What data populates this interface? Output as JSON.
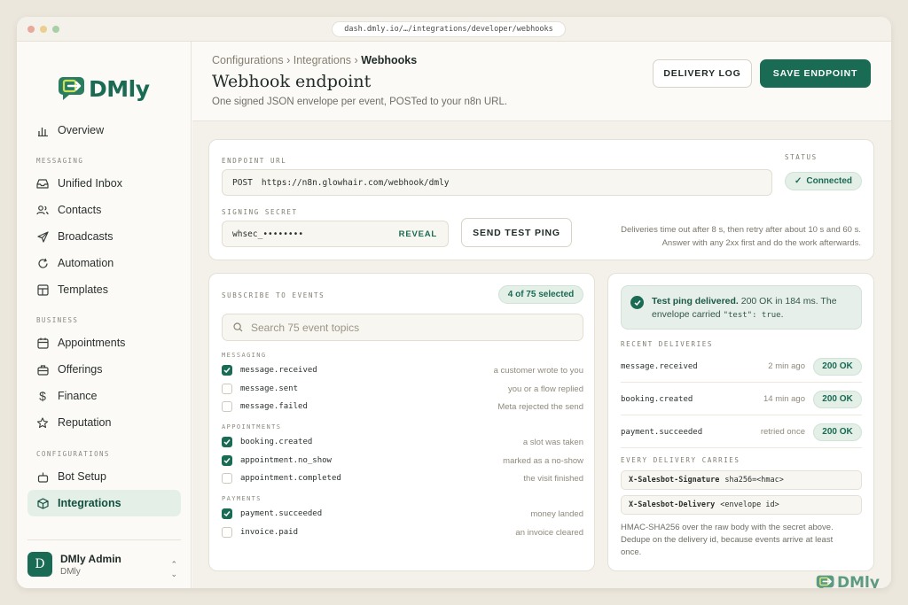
{
  "browser": {
    "url": "dash.dmly.io/…/integrations/developer/webhooks"
  },
  "brand": {
    "name": "DMly",
    "color": "#1a6b54"
  },
  "sidebar": {
    "overview": "Overview",
    "sections": {
      "messaging": "MESSAGING",
      "business": "BUSINESS",
      "configurations": "CONFIGURATIONS"
    },
    "items": {
      "unified_inbox": "Unified Inbox",
      "contacts": "Contacts",
      "broadcasts": "Broadcasts",
      "automation": "Automation",
      "templates": "Templates",
      "appointments": "Appointments",
      "offerings": "Offerings",
      "finance": "Finance",
      "reputation": "Reputation",
      "bot_setup": "Bot Setup",
      "integrations": "Integrations"
    },
    "user": {
      "initial": "D",
      "name": "DMly Admin",
      "org": "DMly"
    }
  },
  "header": {
    "breadcrumb": [
      "Configurations",
      "Integrations",
      "Webhooks"
    ],
    "title": "Webhook endpoint",
    "subtitle": "One signed JSON envelope per event, POSTed to your n8n URL.",
    "delivery_log": "DELIVERY LOG",
    "save_endpoint": "SAVE ENDPOINT"
  },
  "endpoint": {
    "url_label": "ENDPOINT URL",
    "method": "POST",
    "url": "https://n8n.glowhair.com/webhook/dmly",
    "secret_label": "SIGNING SECRET",
    "secret": "whsec_••••••••",
    "reveal": "REVEAL",
    "send_test": "SEND TEST PING",
    "status_label": "STATUS",
    "status": "Connected",
    "note_line1": "Deliveries time out after 8 s, then retry after about 10 s and 60 s.",
    "note_line2": "Answer with any 2xx first and do the work afterwards."
  },
  "events": {
    "label": "SUBSCRIBE TO EVENTS",
    "selected": "4 of 75 selected",
    "search_placeholder": "Search 75 event topics",
    "groups": {
      "messaging": "MESSAGING",
      "appointments": "APPOINTMENTS",
      "payments": "PAYMENTS"
    },
    "items": [
      {
        "name": "message.received",
        "desc": "a customer wrote to you",
        "checked": true
      },
      {
        "name": "message.sent",
        "desc": "you or a flow replied",
        "checked": false
      },
      {
        "name": "message.failed",
        "desc": "Meta rejected the send",
        "checked": false
      },
      {
        "name": "booking.created",
        "desc": "a slot was taken",
        "checked": true
      },
      {
        "name": "appointment.no_show",
        "desc": "marked as a no-show",
        "checked": true
      },
      {
        "name": "appointment.completed",
        "desc": "the visit finished",
        "checked": false
      },
      {
        "name": "payment.succeeded",
        "desc": "money landed",
        "checked": true
      },
      {
        "name": "invoice.paid",
        "desc": "an invoice cleared",
        "checked": false
      }
    ]
  },
  "deliveries": {
    "banner_bold": "Test ping delivered.",
    "banner_rest": " 200 OK in 184 ms. The",
    "banner_line2_pre": "envelope carried ",
    "banner_code": "\"test\": true",
    "banner_end": ".",
    "recent_label": "RECENT DELIVERIES",
    "rows": [
      {
        "name": "message.received",
        "time": "2 min ago",
        "status": "200 OK"
      },
      {
        "name": "booking.created",
        "time": "14 min ago",
        "status": "200 OK"
      },
      {
        "name": "payment.succeeded",
        "time": "retried once",
        "status": "200 OK"
      }
    ],
    "carries_label": "EVERY DELIVERY CARRIES",
    "headers": [
      {
        "name": "X-Salesbot-Signature",
        "value": "sha256=<hmac>"
      },
      {
        "name": "X-Salesbot-Delivery",
        "value": "<envelope id>"
      }
    ],
    "footnote": "HMAC-SHA256 over the raw body with the secret above. Dedupe on the delivery id, because events arrive at least once."
  }
}
